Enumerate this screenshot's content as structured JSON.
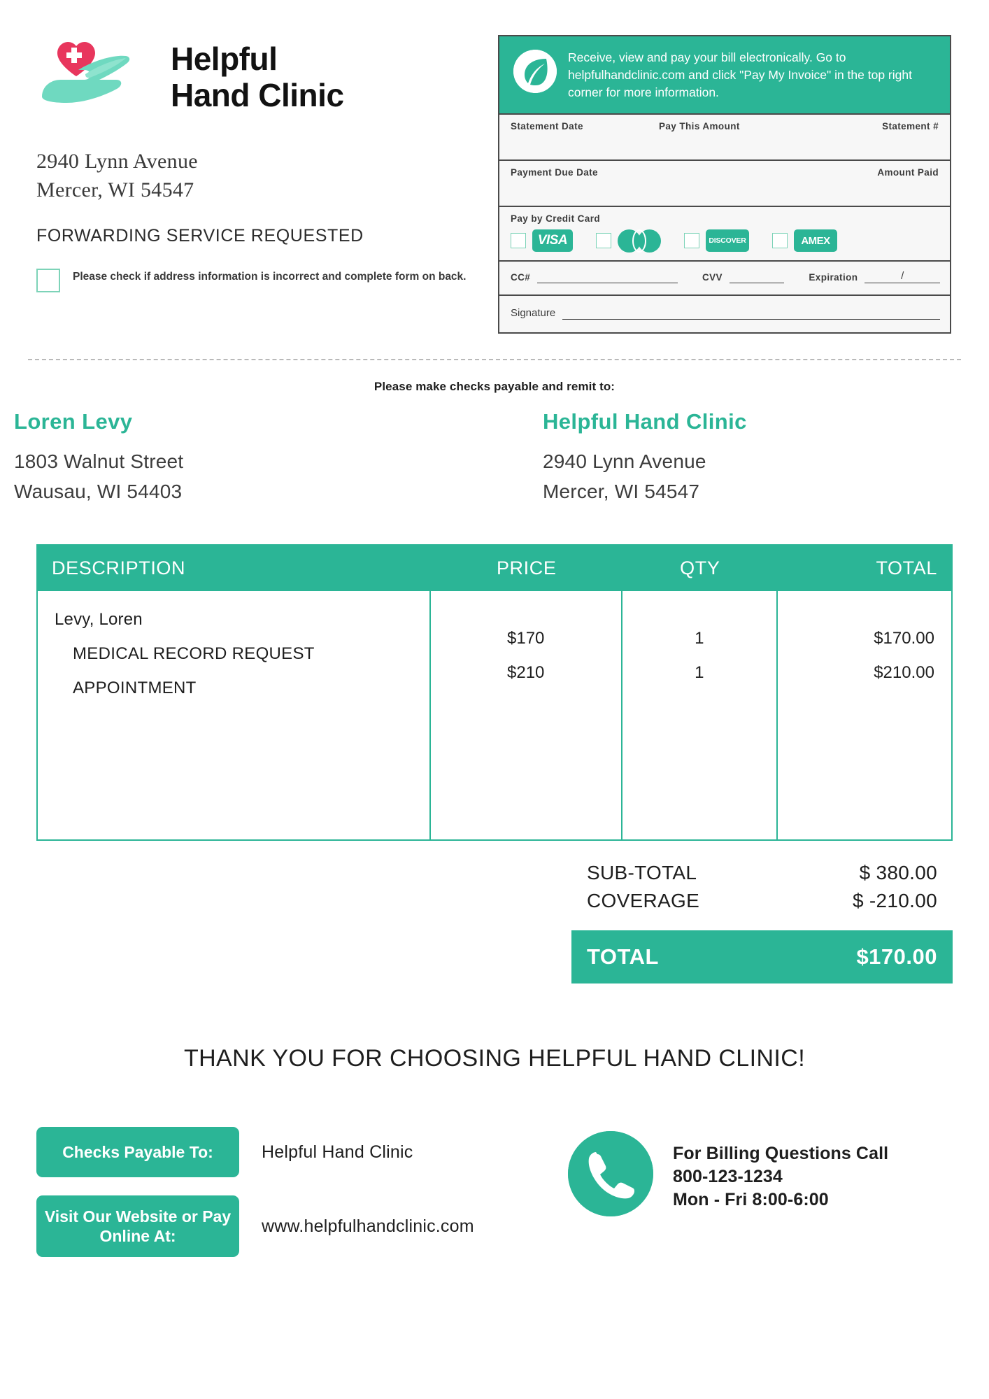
{
  "brand": {
    "accent": "#2bb596",
    "heart": "#e8365d",
    "hand": "#6fd9c0",
    "name_line1": "Helpful",
    "name_line2": "Hand Clinic",
    "logo_icon": "hand-holding-heart-icon"
  },
  "clinic": {
    "address_line1": "2940 Lynn Avenue",
    "address_line2": "Mercer, WI 54547",
    "forwarding": "FORWARDING SERVICE REQUESTED",
    "address_note": "Please check if address information is incorrect and complete form on back."
  },
  "stub": {
    "banner": "Receive, view and pay your bill electronically. Go to helpfulhandclinic.com and click \"Pay My Invoice\" in the top right corner for more information.",
    "banner_icon": "leaf-icon",
    "statement_date_label": "Statement Date",
    "pay_this_amount_label": "Pay This Amount",
    "statement_number_label": "Statement #",
    "payment_due_date_label": "Payment Due Date",
    "amount_paid_label": "Amount Paid",
    "pay_by_credit_card_label": "Pay by Credit Card",
    "cards": [
      {
        "name": "visa",
        "label": "VISA"
      },
      {
        "name": "mastercard",
        "label": ""
      },
      {
        "name": "discover",
        "label": "DISCOVER"
      },
      {
        "name": "amex",
        "label": "AMEX"
      }
    ],
    "cc_label": "CC#",
    "cvv_label": "CVV",
    "expiration_label": "Expiration",
    "expiration_separator": "/",
    "signature_label": "Signature"
  },
  "remit": {
    "heading": "Please make checks payable and remit to:",
    "bill_to": {
      "name": "Loren Levy",
      "line1": "1803 Walnut Street",
      "line2": "Wausau, WI 54403"
    },
    "remit_to": {
      "name": "Helpful Hand Clinic",
      "line1": "2940 Lynn Avenue",
      "line2": "Mercer, WI 54547"
    }
  },
  "table": {
    "columns": [
      "DESCRIPTION",
      "PRICE",
      "QTY",
      "TOTAL"
    ],
    "group_name": "Levy, Loren",
    "rows": [
      {
        "description": "MEDICAL RECORD REQUEST",
        "price": "$170",
        "qty": "1",
        "total": "$170.00"
      },
      {
        "description": "APPOINTMENT",
        "price": "$210",
        "qty": "1",
        "total": "$210.00"
      }
    ]
  },
  "totals": {
    "subtotal_label": "SUB-TOTAL",
    "subtotal_value": "$ 380.00",
    "coverage_label": "COVERAGE",
    "coverage_value": "$ -210.00",
    "total_label": "TOTAL",
    "total_value": "$170.00"
  },
  "thanks": "THANK YOU FOR CHOOSING HELPFUL HAND CLINIC!",
  "footer": {
    "checks_payable_label": "Checks Payable To:",
    "checks_payable_value": "Helpful Hand Clinic",
    "website_label": "Visit Our Website or Pay Online At:",
    "website_value": "www.helpfulhandclinic.com",
    "phone_icon": "phone-icon",
    "billing_line1": "For Billing Questions Call",
    "billing_line2": "800-123-1234",
    "billing_line3": "Mon - Fri 8:00-6:00"
  }
}
